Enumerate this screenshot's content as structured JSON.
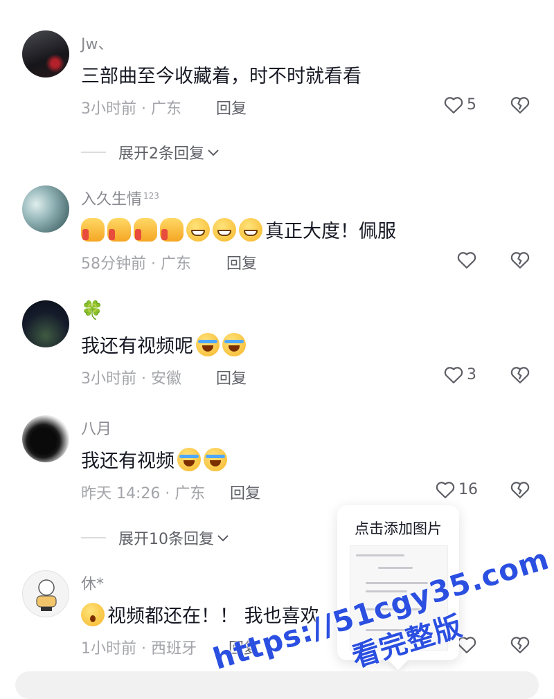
{
  "comments": [
    {
      "username": "Jw、",
      "username_sup": "",
      "text": "三部曲至今收藏着，时不时就看看",
      "meta": "3小时前 · 广东",
      "reply": "回复",
      "likes": "5"
    },
    {
      "username": "入久生情",
      "username_sup": "123",
      "text": "真正大度！佩服",
      "meta": "58分钟前 · 广东",
      "reply": "回复",
      "likes": ""
    },
    {
      "username": "🍀",
      "username_sup": "",
      "text": "我还有视频呢",
      "meta": "3小时前 · 安徽",
      "reply": "回复",
      "likes": "3"
    },
    {
      "username": "八月",
      "username_sup": "",
      "text": "我还有视频",
      "meta": "昨天 14:26 · 广东",
      "reply": "回复",
      "likes": "16"
    },
    {
      "username": "休*",
      "username_sup": "",
      "text": "视频都还在！！ 我也喜欢",
      "meta": "1小时前 · 西班牙",
      "reply": "回复",
      "likes": ""
    }
  ],
  "expand_replies": [
    {
      "label": "展开2条回复"
    },
    {
      "label": "展开10条回复"
    }
  ],
  "popup": {
    "title": "点击添加图片"
  },
  "watermark": {
    "line1": "https://51cgy35.com",
    "line2": "看完整版"
  },
  "icons": {
    "like": "heart-outline-icon",
    "dislike": "broken-heart-icon",
    "expand": "chevron-down-icon"
  },
  "colors": {
    "watermark": "#2b4fe0",
    "text": "#161823",
    "meta": "#a3a4a9"
  }
}
